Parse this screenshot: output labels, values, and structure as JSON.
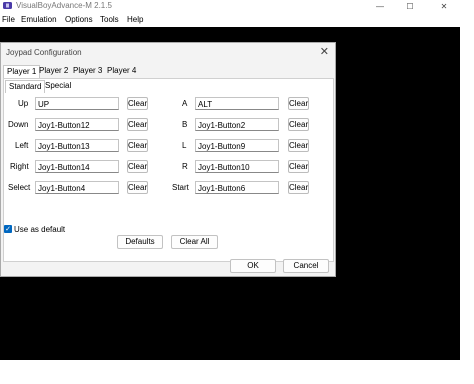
{
  "app": {
    "title": "VisualBoyAdvance-M 2.1.5"
  },
  "menu": [
    "File",
    "Emulation",
    "Options",
    "Tools",
    "Help"
  ],
  "window_controls": {
    "minimize": "—",
    "maximize": "☐",
    "close": "✕"
  },
  "dialog": {
    "title": "Joypad Configuration",
    "close": "✕",
    "player_tabs": [
      "Player 1",
      "Player 2",
      "Player 3",
      "Player 4"
    ],
    "sub_tabs": [
      "Standard",
      "Special"
    ],
    "clear_label": "Clear",
    "left_keys": [
      {
        "label": "Up",
        "value": "UP"
      },
      {
        "label": "Down",
        "value": "Joy1-Button12"
      },
      {
        "label": "Left",
        "value": "Joy1-Button13"
      },
      {
        "label": "Right",
        "value": "Joy1-Button14"
      },
      {
        "label": "Select",
        "value": "Joy1-Button4"
      }
    ],
    "right_keys": [
      {
        "label": "A",
        "value": "ALT"
      },
      {
        "label": "B",
        "value": "Joy1-Button2"
      },
      {
        "label": "L",
        "value": "Joy1-Button9"
      },
      {
        "label": "R",
        "value": "Joy1-Button10"
      },
      {
        "label": "Start",
        "value": "Joy1-Button6"
      }
    ],
    "use_default": {
      "label": "Use as default",
      "checked": true
    },
    "defaults_button": "Defaults",
    "clear_all_button": "Clear All",
    "ok_button": "OK",
    "cancel_button": "Cancel"
  }
}
